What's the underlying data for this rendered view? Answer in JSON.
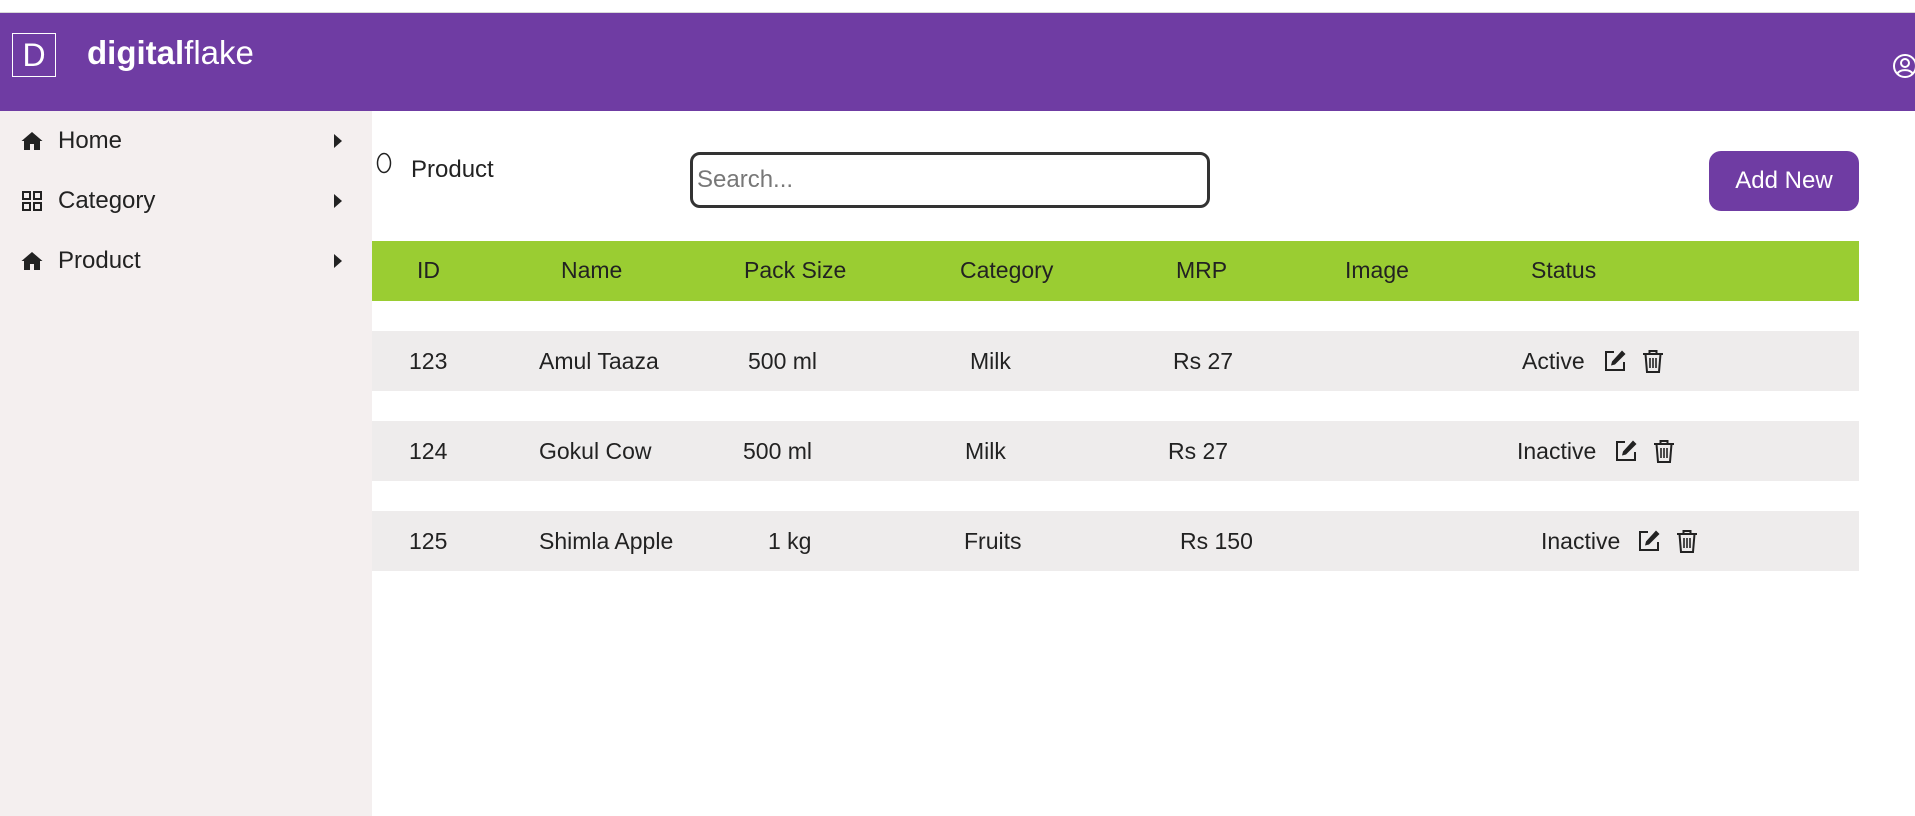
{
  "brand": {
    "logo_letter": "D",
    "name_bold": "digital",
    "name_regular": "flake"
  },
  "header": {
    "user_icon": "user-circle-icon"
  },
  "colors": {
    "header": "#6f3ca3",
    "table_header": "#9acd32",
    "row": "#eeecec",
    "sidebar": "#f4efef",
    "button": "#6f3ca3"
  },
  "sidebar": {
    "items": [
      {
        "label": "Home",
        "icon": "home-icon"
      },
      {
        "label": "Category",
        "icon": "grid-icon"
      },
      {
        "label": "Product",
        "icon": "home-icon"
      }
    ]
  },
  "page": {
    "title": "Product",
    "title_icon": "circle-icon"
  },
  "search": {
    "placeholder": "Search...",
    "value": ""
  },
  "actions": {
    "add_new": "Add New"
  },
  "table": {
    "columns": [
      "ID",
      "Name",
      "Pack Size",
      "Category",
      "MRP",
      "Image",
      "Status"
    ],
    "rows": [
      {
        "id": "123",
        "name": "Amul Taaza",
        "pack_size": "500 ml",
        "category": "Milk",
        "mrp": "Rs 27",
        "image": "",
        "status": "Active"
      },
      {
        "id": "124",
        "name": "Gokul Cow",
        "pack_size": "500 ml",
        "category": "Milk",
        "mrp": "Rs 27",
        "image": "",
        "status": "Inactive"
      },
      {
        "id": "125",
        "name": "Shimla Apple",
        "pack_size": "1 kg",
        "category": "Fruits",
        "mrp": "Rs 150",
        "image": "",
        "status": "Inactive"
      }
    ]
  }
}
